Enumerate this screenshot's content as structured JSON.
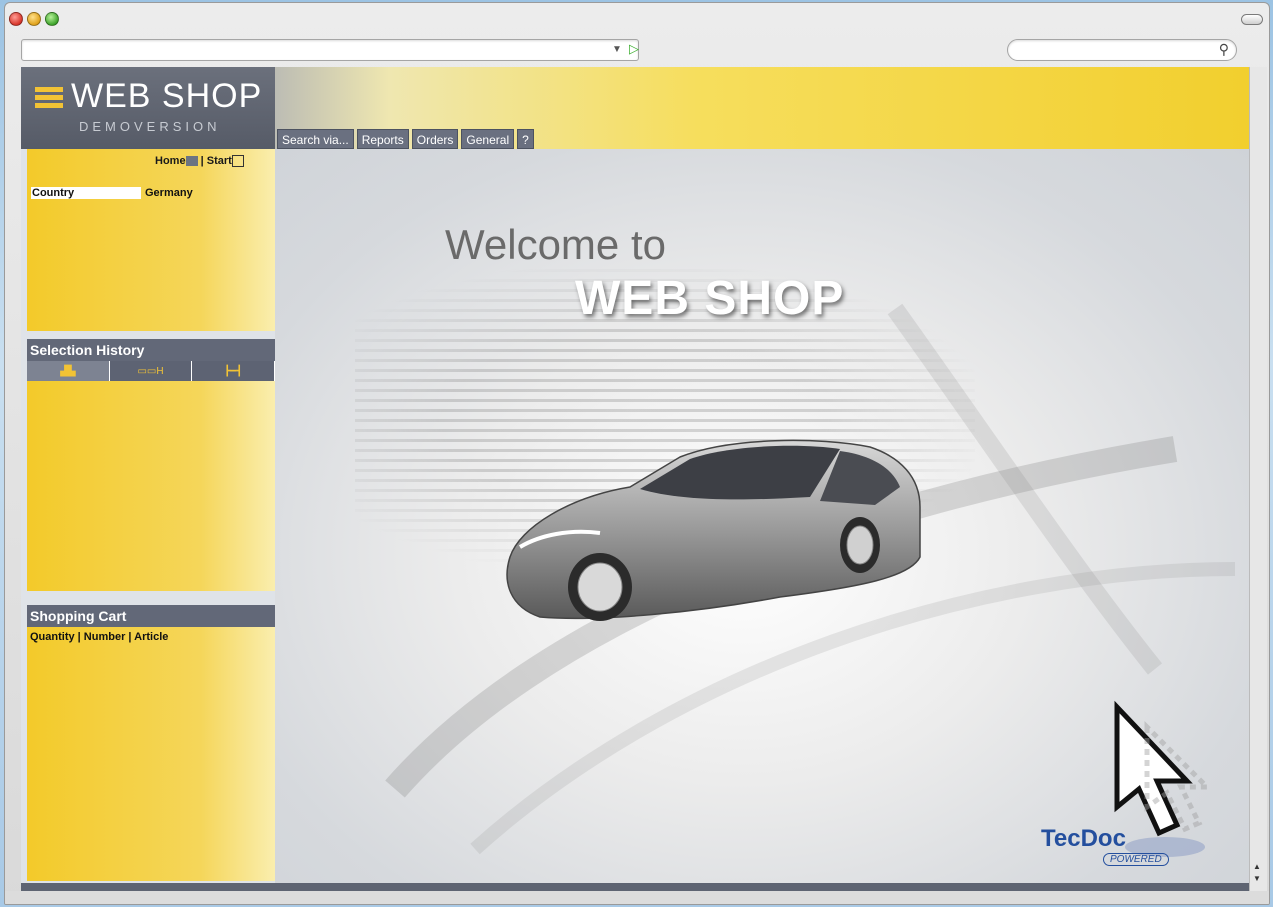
{
  "browser": {
    "url": "",
    "search_placeholder": ""
  },
  "header": {
    "logo_title": "WEB SHOP",
    "logo_subtitle": "DEMOVERSION",
    "nav": [
      "Search via...",
      "Reports",
      "Orders",
      "General",
      "?"
    ]
  },
  "sidebar": {
    "home_label": "Home",
    "start_label": "Start",
    "separator": "|",
    "country_label": "Country",
    "country_value": "Germany",
    "history_title": "Selection History",
    "cart_title": "Shopping Cart",
    "cart_columns": "Quantity  |  Number  |  Article"
  },
  "main": {
    "welcome_line": "Welcome to",
    "brand_line": "WEB SHOP",
    "tecdoc_label": "TecDoc",
    "powered_label": "POWERED"
  },
  "colors": {
    "sidebar_yellow": "#f3ca2a",
    "header_gray": "#626878",
    "brand_blue": "#244f9e"
  }
}
